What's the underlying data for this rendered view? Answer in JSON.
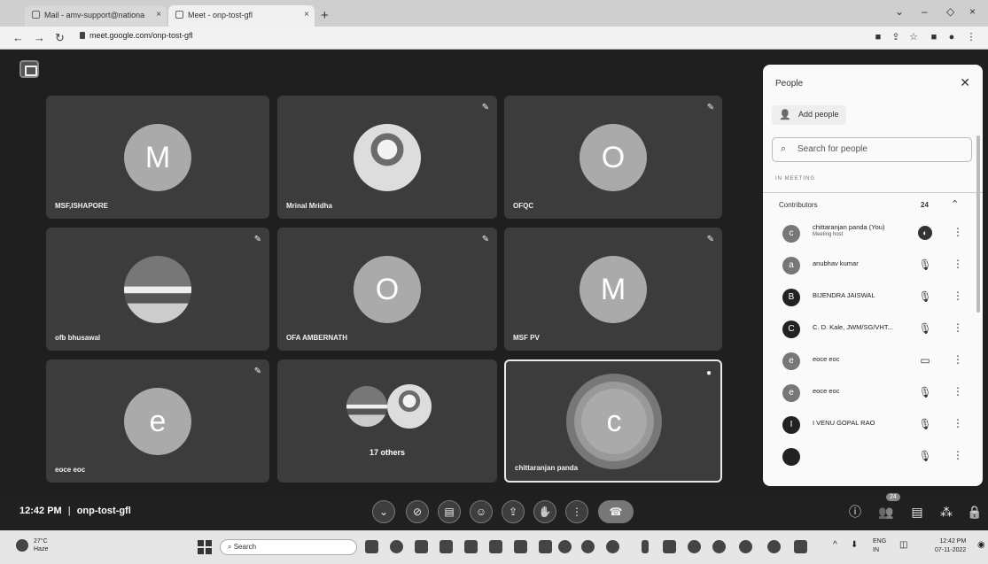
{
  "browser": {
    "tabs": [
      {
        "label": "Mail - amv-support@nationa"
      },
      {
        "label": "Meet - onp-tost-gfl"
      }
    ],
    "url": "meet.google.com/onp-tost-gfl"
  },
  "tiles": [
    {
      "initial": "M",
      "name": "MSF,ISHAPORE"
    },
    {
      "initial": "",
      "name": "Mrinal Mridha"
    },
    {
      "initial": "O",
      "name": "OFQC"
    },
    {
      "initial": "",
      "name": "ofb bhusawal"
    },
    {
      "initial": "O",
      "name": "OFA AMBERNATH"
    },
    {
      "initial": "M",
      "name": "MSF PV"
    },
    {
      "initial": "e",
      "name": "eoce eoc"
    },
    {
      "initial": "",
      "name": "17 others"
    },
    {
      "initial": "c",
      "name": "chittaranjan panda"
    }
  ],
  "bottombar": {
    "time": "12:42 PM",
    "separator": "|",
    "meeting_code": "onp-tost-gfl",
    "participants_badge": "24"
  },
  "people_panel": {
    "title": "People",
    "add_people": "Add people",
    "search_placeholder": "Search for people",
    "section": "IN MEETING",
    "group_label": "Contributors",
    "group_count": "24",
    "people": [
      {
        "initial": "c",
        "name": "chittaranjan panda (You)",
        "sub": "Meeting host",
        "mic": "on"
      },
      {
        "initial": "a",
        "name": "anubhav kumar",
        "sub": "",
        "mic": "muted"
      },
      {
        "initial": "B",
        "name": "BIJENDRA JAISWAL",
        "sub": "",
        "mic": "muted"
      },
      {
        "initial": "C",
        "name": "C. D. Kale, JWM/SG/VHT...",
        "sub": "",
        "mic": "muted"
      },
      {
        "initial": "e",
        "name": "eoce eoc",
        "sub": "",
        "mic": "present"
      },
      {
        "initial": "e",
        "name": "eoce eoc",
        "sub": "",
        "mic": "muted"
      },
      {
        "initial": "I",
        "name": "I VENU GOPAL RAO",
        "sub": "",
        "mic": "muted"
      }
    ]
  },
  "taskbar": {
    "weather_temp": "27°C",
    "weather_desc": "Haze",
    "search_label": "Search",
    "lang_line1": "ENG",
    "lang_line2": "IN",
    "clock_time": "12:42 PM",
    "clock_date": "07-11-2022"
  }
}
